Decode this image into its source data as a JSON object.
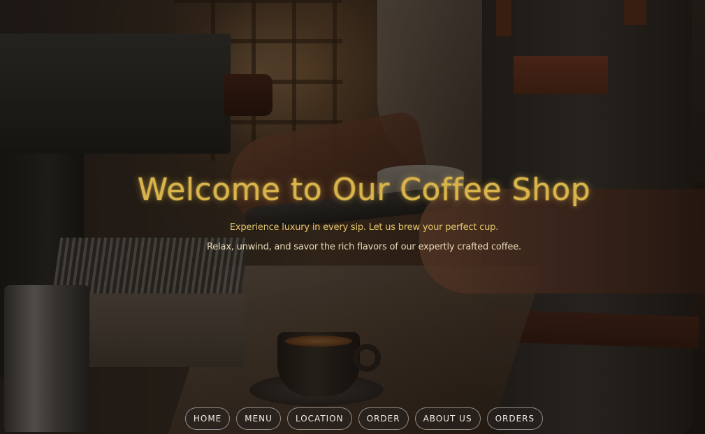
{
  "hero": {
    "title": "Welcome to Our Coffee Shop",
    "tagline_1": "Experience luxury in every sip. Let us brew your perfect cup.",
    "tagline_2": "Relax, unwind, and savor the rich flavors of our expertly crafted coffee.",
    "background_image": "barista pulling espresso shot with cup on counter"
  },
  "nav": {
    "items": [
      {
        "label": "HOME"
      },
      {
        "label": "MENU"
      },
      {
        "label": "LOCATION"
      },
      {
        "label": "ORDER"
      },
      {
        "label": "ABOUT US"
      },
      {
        "label": "ORDERS"
      }
    ]
  },
  "colors": {
    "title": "#d9b44a",
    "tagline": "#e6c76c",
    "nav_text": "#f0ece6",
    "nav_border": "#e6e6e6",
    "overlay": "#0f0a07"
  }
}
